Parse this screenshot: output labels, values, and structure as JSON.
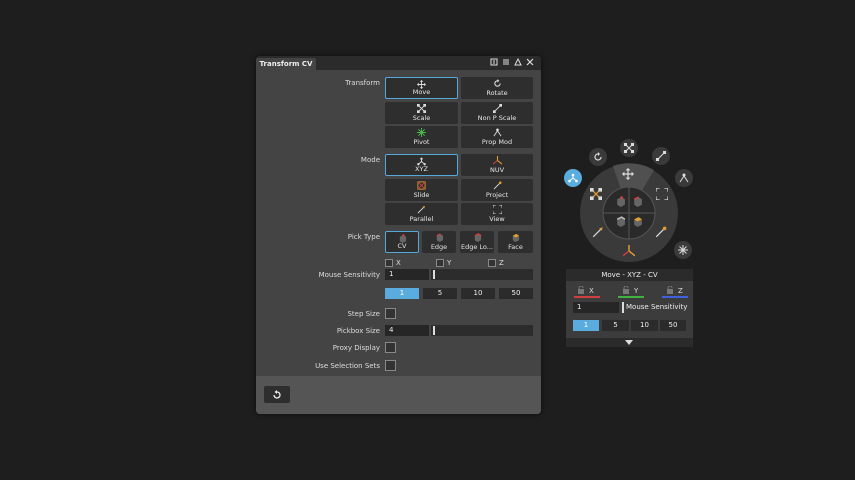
{
  "panel": {
    "title": "Transform CV",
    "titlebar_icons": [
      "pin-icon",
      "menu-icon",
      "up-triangle-icon",
      "close-icon"
    ],
    "transform": {
      "label": "Transform",
      "buttons": [
        {
          "label": "Move",
          "icon": "move-icon",
          "selected": true
        },
        {
          "label": "Rotate",
          "icon": "rotate-icon",
          "selected": false
        },
        {
          "label": "Scale",
          "icon": "scale-icon",
          "selected": false
        },
        {
          "label": "Non P Scale",
          "icon": "non-p-scale-icon",
          "selected": false
        },
        {
          "label": "Pivot",
          "icon": "pivot-icon",
          "selected": false
        },
        {
          "label": "Prop Mod",
          "icon": "prop-mod-icon",
          "selected": false
        }
      ]
    },
    "mode": {
      "label": "Mode",
      "buttons": [
        {
          "label": "XYZ",
          "icon": "xyz-axis-icon",
          "selected": true
        },
        {
          "label": "NUV",
          "icon": "nuv-axis-icon",
          "selected": false
        },
        {
          "label": "Slide",
          "icon": "slide-icon",
          "selected": false
        },
        {
          "label": "Project",
          "icon": "project-icon",
          "selected": false
        },
        {
          "label": "Parallel",
          "icon": "parallel-icon",
          "selected": false
        },
        {
          "label": "View",
          "icon": "view-icon",
          "selected": false
        }
      ]
    },
    "pick_type": {
      "label": "Pick Type",
      "buttons": [
        {
          "label": "CV",
          "icon": "cv-icon",
          "selected": true
        },
        {
          "label": "Edge",
          "icon": "edge-icon",
          "selected": false
        },
        {
          "label": "Edge Lo...",
          "icon": "edge-loop-icon",
          "selected": false
        },
        {
          "label": "Face",
          "icon": "face-icon",
          "selected": false
        }
      ]
    },
    "axes": [
      "X",
      "Y",
      "Z"
    ],
    "mouse_sensitivity": {
      "label": "Mouse Sensitivity",
      "value": "1",
      "presets": [
        "1",
        "5",
        "10",
        "50"
      ],
      "selected": "1"
    },
    "step_size": {
      "label": "Step Size"
    },
    "pickbox_size": {
      "label": "Pickbox Size",
      "value": "4"
    },
    "proxy_display": {
      "label": "Proxy Display"
    },
    "use_selection_sets": {
      "label": "Use Selection Sets"
    },
    "footer": {
      "reset_icon": "reset-icon"
    }
  },
  "mini_panel": {
    "title": "Move  -  XYZ  -  CV",
    "axes": [
      "X",
      "Y",
      "Z"
    ],
    "axis_colors": [
      "#d04040",
      "#40b040",
      "#4060e0"
    ],
    "sensitivity_value": "1",
    "sensitivity_label": "Mouse Sensitivity",
    "presets": [
      "1",
      "5",
      "10",
      "50"
    ],
    "selected": "1"
  },
  "colors": {
    "accent": "#56a8d8",
    "background": "#1e1e1e",
    "panel": "#444444"
  }
}
